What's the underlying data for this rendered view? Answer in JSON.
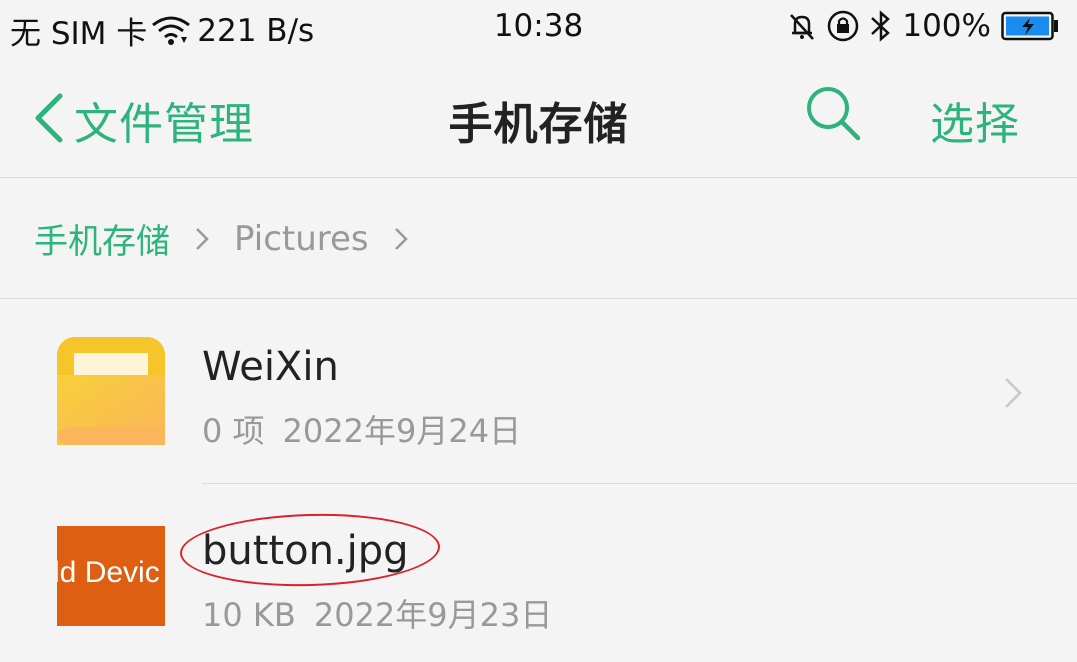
{
  "status_bar": {
    "carrier": "无 SIM 卡",
    "speed": "221 B/s",
    "time": "10:38",
    "battery": "100%"
  },
  "header": {
    "back_label": "文件管理",
    "title": "手机存储",
    "select_label": "选择"
  },
  "breadcrumb": {
    "root": "手机存储",
    "items": [
      "Pictures"
    ]
  },
  "files": [
    {
      "name": "WeiXin",
      "info": "0 项",
      "date": "2022年9月24日",
      "type": "folder"
    },
    {
      "name": "button.jpg",
      "info": "10 KB",
      "date": "2022年9月23日",
      "type": "image",
      "thumbnail_text": "dd Devic"
    }
  ],
  "colors": {
    "accent": "#2db37c",
    "folder": "#f7c531",
    "thumbnail": "#de5f12",
    "annotation": "#d8232a"
  }
}
